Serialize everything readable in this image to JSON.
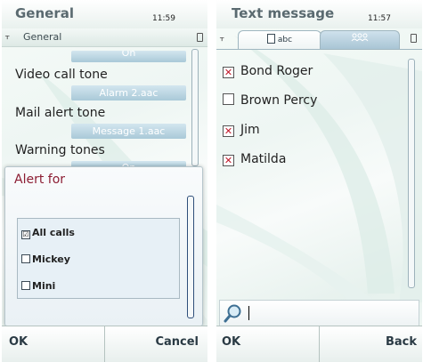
{
  "left_screen": {
    "title": "General",
    "clock": "11:59",
    "context_label": "General",
    "top_value": "On",
    "settings": [
      {
        "label": "Video call tone",
        "value": "Alarm 2.aac"
      },
      {
        "label": "Mail alert tone",
        "value": "Message 1.aac"
      },
      {
        "label": "Warning tones",
        "value": "On"
      }
    ],
    "popup": {
      "title": "Alert for",
      "options": [
        {
          "label": "All calls",
          "checked": true,
          "mark": "☑"
        },
        {
          "label": "Mickey",
          "checked": false,
          "mark": ""
        },
        {
          "label": "Mini",
          "checked": false,
          "mark": ""
        }
      ]
    },
    "softkeys": {
      "left": "OK",
      "right": "Cancel"
    }
  },
  "right_screen": {
    "title": "Text message",
    "clock": "11:57",
    "tabs": [
      {
        "label": "abc",
        "icon": "document-icon",
        "active": true
      },
      {
        "label": "",
        "icon": "contacts-group-icon",
        "active": false
      }
    ],
    "recipients": [
      {
        "name": "Bond Roger",
        "checked": true,
        "mark": "✕"
      },
      {
        "name": "Brown Percy",
        "checked": false,
        "mark": ""
      },
      {
        "name": "Jim",
        "checked": true,
        "mark": "✕"
      },
      {
        "name": "Matilda",
        "checked": true,
        "mark": "✕"
      }
    ],
    "search": {
      "icon": "magnifier-icon",
      "value": ""
    },
    "softkeys": {
      "left": "OK",
      "right": "Back"
    }
  },
  "colors": {
    "accent_popup_title": "#8c1d33",
    "value_bar": "#a9c9d8",
    "check_mark": "#c0182a"
  }
}
